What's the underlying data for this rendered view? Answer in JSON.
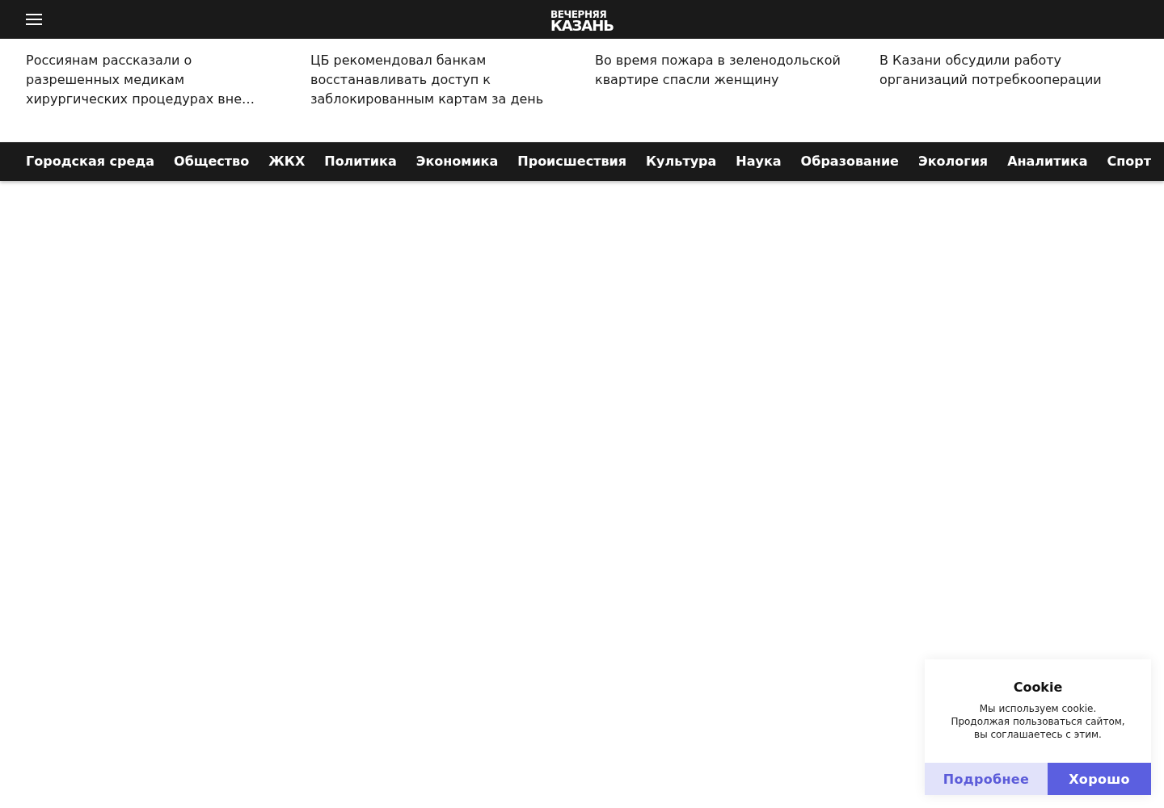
{
  "header": {
    "logo": {
      "line_1": "ВЕЧЕРНЯЯ",
      "line_2": "КАЗАНЬ"
    }
  },
  "headlines": [
    "Россиянам рассказали о разрешенных медикам хирургических процедурах вне…",
    "ЦБ рекомендовал банкам восстанавливать доступ к заблокированным картам за день",
    "Во время пожара в зеленодольской квартире спасли женщину",
    "В Казани обсудили работу организаций потребкооперации"
  ],
  "sections": [
    "Городская среда",
    "Общество",
    "ЖКХ",
    "Политика",
    "Экономика",
    "Происшествия",
    "Культура",
    "Наука",
    "Образование",
    "Экология",
    "Аналитика",
    "Спорт"
  ],
  "cookie_notice": {
    "title": "Cookie",
    "text": "Мы используем cookie.\nПродолжая пользоваться сайтом,\nвы соглашаетесь с этим.",
    "buttons": [
      {
        "label": "Подробнее",
        "kind": "secondary"
      },
      {
        "label": "Хорошо",
        "kind": "primary"
      }
    ]
  }
}
